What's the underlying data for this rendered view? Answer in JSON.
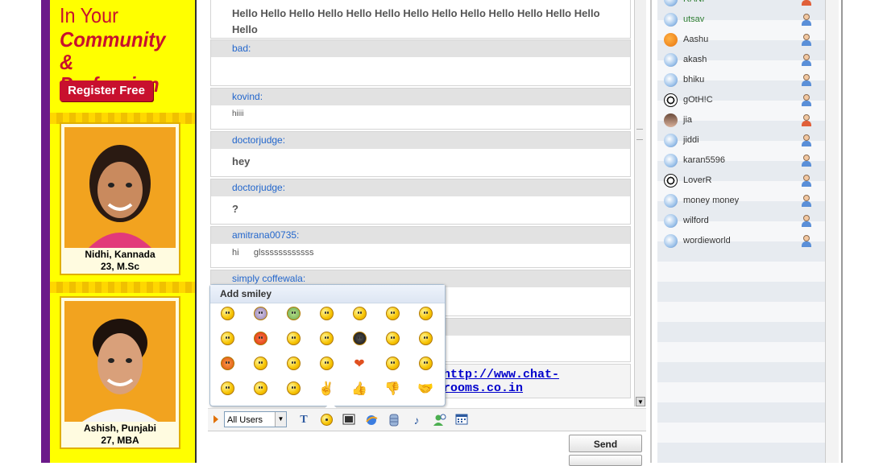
{
  "ad": {
    "headline_partial": "In Your",
    "headline_bold": "Community &",
    "headline_bold2": "Profession",
    "register_label": "Register Free",
    "profiles": [
      {
        "name": "Nidhi, Kannada",
        "detail": "23, M.Sc"
      },
      {
        "name": "Ashish, Punjabi",
        "detail": "27, MBA"
      }
    ]
  },
  "messages": {
    "top_text_line1": "Hello Hello Hello Hello Hello Hello Hello Hello Hello Hello Hello Hello Hello",
    "top_text_line2": "Hello",
    "m1": {
      "name": "bad:",
      "text": ""
    },
    "m2": {
      "name": "kovind:",
      "text": "hiiii"
    },
    "m3": {
      "name": "doctorjudge:",
      "text": "hey"
    },
    "m4": {
      "name": "doctorjudge:",
      "text": "?"
    },
    "m5": {
      "name": "amitrana00735:",
      "text": "hi      glssssssssssss"
    },
    "m6": {
      "name": "simply coffewala:",
      "text": ""
    },
    "link": "http://www.chat-rooms.co.in"
  },
  "smiley_popup": {
    "title": "Add smiley",
    "icons": [
      "grin-icon",
      "cool-icon",
      "thumbs-up-icon",
      "thumbs-down-icon",
      "handshake-icon",
      "heart-icon",
      "victory-icon"
    ]
  },
  "toolbar": {
    "recipient": "All Users",
    "send_label": "Send"
  },
  "users": [
    {
      "name": "RANI",
      "avatar": "blue",
      "gender": "red"
    },
    {
      "name": "utsav",
      "avatar": "blue",
      "gender": "blue"
    },
    {
      "name": "Aashu",
      "avatar": "pumpkin",
      "gender": "blue"
    },
    {
      "name": "akash",
      "avatar": "blue",
      "gender": "blue"
    },
    {
      "name": "bhiku",
      "avatar": "blue",
      "gender": "blue"
    },
    {
      "name": "gOtH!C",
      "avatar": "ball",
      "gender": "blue"
    },
    {
      "name": "jia",
      "avatar": "photo",
      "gender": "red"
    },
    {
      "name": "jiddi",
      "avatar": "blue",
      "gender": "blue"
    },
    {
      "name": "karan5596",
      "avatar": "blue",
      "gender": "blue"
    },
    {
      "name": "LoverR",
      "avatar": "ball",
      "gender": "blue"
    },
    {
      "name": "money money",
      "avatar": "blue",
      "gender": "blue"
    },
    {
      "name": "wilford",
      "avatar": "blue",
      "gender": "blue"
    },
    {
      "name": "wordieworld",
      "avatar": "blue",
      "gender": "blue"
    }
  ],
  "colors": {
    "ad_bg": "#ffff00",
    "ad_red": "#c8102e",
    "name_blue": "#2266cc",
    "link_blue": "#0000cc"
  }
}
